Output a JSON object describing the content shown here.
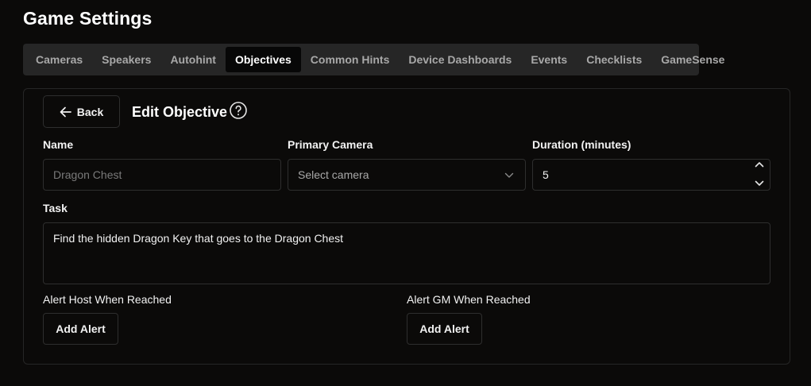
{
  "page": {
    "title": "Game Settings"
  },
  "tabs": [
    {
      "label": "Cameras"
    },
    {
      "label": "Speakers"
    },
    {
      "label": "Autohint"
    },
    {
      "label": "Objectives",
      "active": true
    },
    {
      "label": "Common Hints"
    },
    {
      "label": "Device Dashboards"
    },
    {
      "label": "Events"
    },
    {
      "label": "Checklists"
    },
    {
      "label": "GameSense"
    }
  ],
  "editor": {
    "back_label": "Back",
    "title": "Edit Objective",
    "help_icon": "question-circle-icon",
    "name": {
      "label": "Name",
      "value": "",
      "placeholder": "Dragon Chest"
    },
    "camera": {
      "label": "Primary Camera",
      "placeholder": "Select camera",
      "icon": "chevron-down-icon"
    },
    "duration": {
      "label": "Duration (minutes)",
      "value": "5"
    },
    "task": {
      "label": "Task",
      "value": "Find the hidden Dragon Key that goes to the Dragon Chest"
    },
    "alert_host": {
      "label": "Alert Host When Reached",
      "button": "Add Alert"
    },
    "alert_gm": {
      "label": "Alert GM When Reached",
      "button": "Add Alert"
    }
  },
  "colors": {
    "background": "#0b0a09",
    "tabbar": "#262626",
    "active_tab": "#070707",
    "border": "#2e2e2e",
    "muted_text": "#a8a8a8"
  }
}
